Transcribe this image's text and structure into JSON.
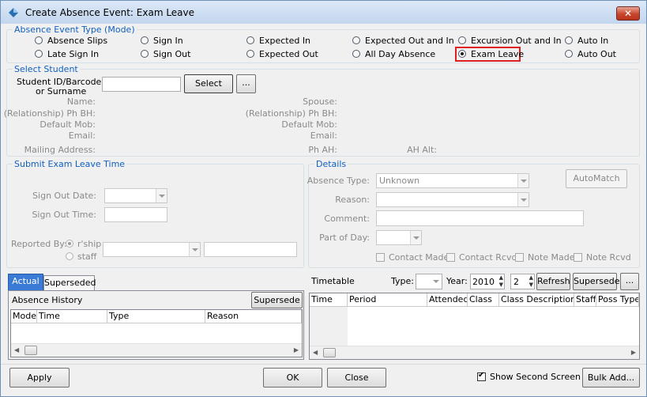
{
  "window": {
    "title": "Create Absence Event: Exam Leave",
    "close": "✕"
  },
  "mode": {
    "title": "Absence Event Type (Mode)",
    "options": [
      {
        "label": "Absence Slips",
        "selected": false
      },
      {
        "label": "Late Sign In",
        "selected": false
      },
      {
        "label": "Sign In",
        "selected": false
      },
      {
        "label": "Sign Out",
        "selected": false
      },
      {
        "label": "Expected In",
        "selected": false
      },
      {
        "label": "Expected Out",
        "selected": false
      },
      {
        "label": "Expected Out and In",
        "selected": false
      },
      {
        "label": "All Day Absence",
        "selected": false
      },
      {
        "label": "Excursion Out and In",
        "selected": false
      },
      {
        "label": "Exam Leave",
        "selected": true
      },
      {
        "label": "Auto In",
        "selected": false
      },
      {
        "label": "Auto Out",
        "selected": false
      }
    ]
  },
  "student": {
    "title": "Select Student",
    "id_label_1": "Student ID/Barcode:",
    "id_label_2": "or Surname",
    "id_value": "",
    "select": "Select",
    "more": "...",
    "name": "Name:",
    "rel_ph": "(Relationship) Ph BH:",
    "default_mob": "Default Mob:",
    "email": "Email:",
    "mailing": "Mailing Address:",
    "spouse": "Spouse:",
    "rel_ph2": "(Relationship) Ph BH:",
    "default_mob2": "Default Mob:",
    "email2": "Email:",
    "ph_ah": "Ph AH:",
    "ah_alt": "AH Alt:"
  },
  "submit": {
    "title": "Submit Exam Leave Time",
    "sign_out_date": "Sign Out Date:",
    "sign_out_time": "Sign Out Time:",
    "reported_by": "Reported By:",
    "rship": "r'ship",
    "staff": "staff"
  },
  "details": {
    "title": "Details",
    "absence_type_label": "Absence Type:",
    "absence_type_value": "Unknown",
    "reason": "Reason:",
    "comment": "Comment:",
    "part_of_day": "Part of Day:",
    "automatch": "AutoMatch",
    "contact_made": "Contact Made",
    "contact_rcvd": "Contact Rcvd",
    "note_made": "Note Made",
    "note_rcvd": "Note Rcvd"
  },
  "history": {
    "tabs": [
      "Actual",
      "Superseded"
    ],
    "title": "Absence History",
    "supersede": "Supersede",
    "columns": [
      "Mode",
      "Time",
      "Type",
      "Reason"
    ]
  },
  "timetable": {
    "title": "Timetable",
    "type_label": "Type:",
    "type_value": "",
    "year_label": "Year:",
    "year_value": "2010",
    "num_value": "2",
    "refresh": "Refresh",
    "supersede": "Supersede",
    "more": "...",
    "columns": [
      "Time",
      "Period",
      "Attended",
      "Class",
      "Class Description",
      "Staff",
      "Poss Type"
    ]
  },
  "footer": {
    "apply": "Apply",
    "ok": "OK",
    "close": "Close",
    "show_second": "Show Second Screen",
    "bulk_add": "Bulk Add..."
  },
  "colors": {
    "highlight": "#e02020",
    "group_title": "#1060c0"
  }
}
